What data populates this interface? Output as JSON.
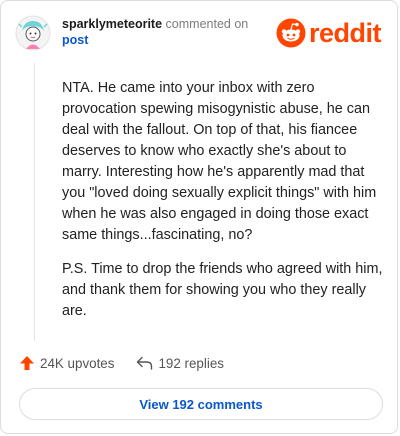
{
  "header": {
    "username": "sparklymeteorite",
    "action_text": "commented on",
    "post_link": "post"
  },
  "brand": {
    "wordmark": "reddit",
    "accent_color": "#ff4500"
  },
  "comment": {
    "paragraphs": [
      "NTA. He came into your inbox with zero provocation spewing misogynistic abuse, he can deal with the fallout. On top of that, his fiancee deserves to know who exactly she's about to marry. Interesting how he's apparently mad that you \"loved doing sexually explicit things\" with him when he was also engaged in doing those exact same things...fascinating, no?",
      "P.S. Time to drop the friends who agreed with him, and thank them for showing you who they really are."
    ]
  },
  "actions": {
    "upvotes": "24K upvotes",
    "replies": "192 replies",
    "upvote_icon": "upvote-arrow-icon",
    "reply_icon": "reply-arrow-icon"
  },
  "footer": {
    "view_comments_label": "View 192 comments"
  },
  "colors": {
    "link_blue": "#0a58ca",
    "upvote_orange": "#ff4500"
  }
}
